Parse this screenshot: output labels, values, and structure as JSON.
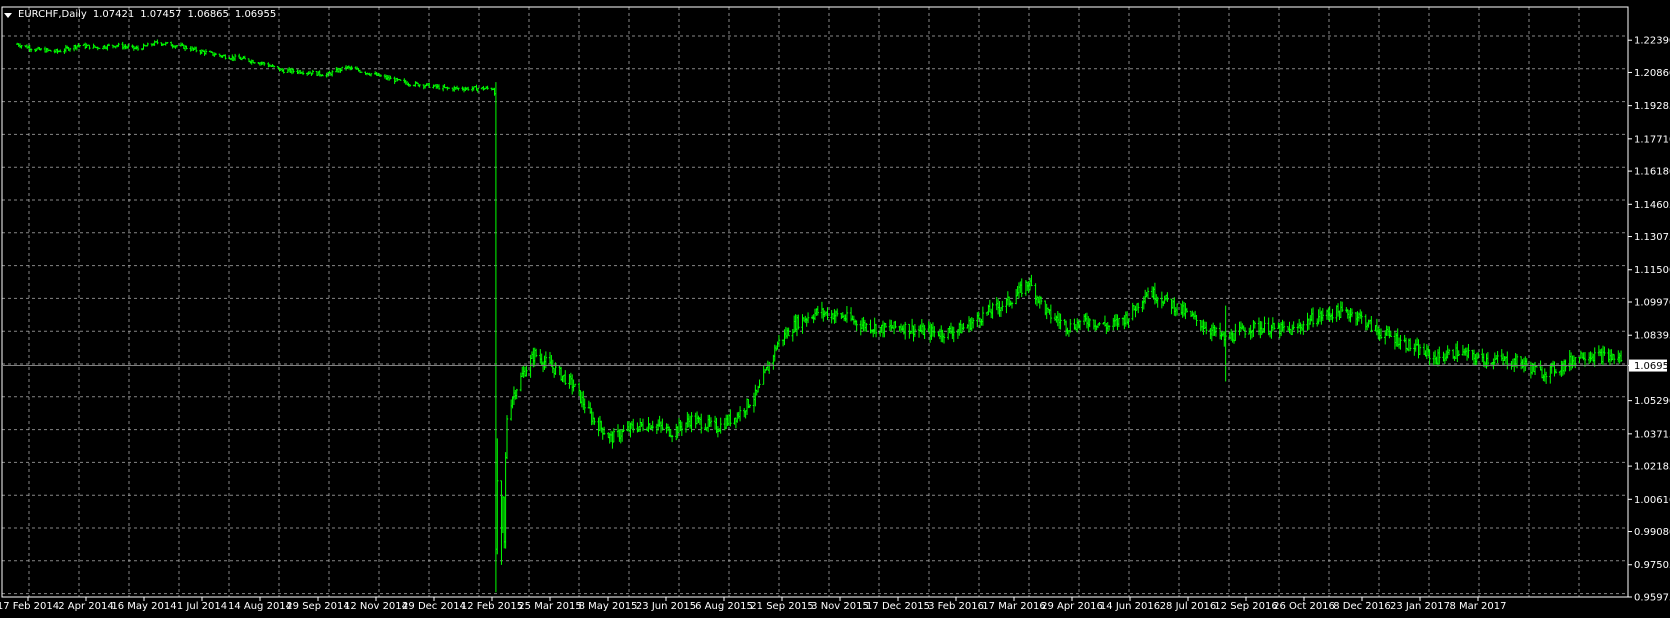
{
  "app": {
    "symbol_label": "EURCHF,Daily",
    "ohlc": [
      "1.07421",
      "1.07457",
      "1.06865",
      "1.06955"
    ]
  },
  "colors": {
    "background": "#000000",
    "bar": "#00ff00",
    "grid": "#c0c0c0",
    "frame": "#ffffff",
    "text": "#ffffff",
    "bid_line": "#808080"
  },
  "chart_data": {
    "type": "line",
    "title": "EURCHF,Daily",
    "xlabel": "",
    "ylabel": "",
    "ylim": [
      0.95975,
      1.23965
    ],
    "grid": true,
    "price_ticks": [
      "1.22390",
      "1.20860",
      "1.19285",
      "1.17710",
      "1.16180",
      "1.14605",
      "1.13075",
      "1.11500",
      "1.09970",
      "1.08395",
      "1.06955",
      "1.05290",
      "1.03715",
      "1.02185",
      "1.00610",
      "0.99080",
      "0.97505",
      "0.95975"
    ],
    "current_price": "1.06955",
    "date_ticks": [
      "17 Feb 2014",
      "2 Apr 2014",
      "16 May 2014",
      "1 Jul 2014",
      "14 Aug 2014",
      "29 Sep 2014",
      "12 Nov 2014",
      "29 Dec 2014",
      "12 Feb 2015",
      "25 Mar 2015",
      "8 May 2015",
      "23 Jun 2015",
      "6 Aug 2015",
      "21 Sep 2015",
      "3 Nov 2015",
      "17 Dec 2015",
      "3 Feb 2016",
      "17 Mar 2016",
      "29 Apr 2016",
      "14 Jun 2016",
      "28 Jul 2016",
      "12 Sep 2016",
      "26 Oct 2016",
      "8 Dec 2016",
      "23 Jan 2017",
      "8 Mar 2017"
    ],
    "x": [
      "2014-02-04",
      "2014-02-17",
      "2014-03-05",
      "2014-03-20",
      "2014-04-02",
      "2014-04-16",
      "2014-05-02",
      "2014-05-16",
      "2014-06-02",
      "2014-06-17",
      "2014-07-01",
      "2014-07-16",
      "2014-07-31",
      "2014-08-14",
      "2014-08-29",
      "2014-09-15",
      "2014-09-29",
      "2014-10-14",
      "2014-10-28",
      "2014-11-12",
      "2014-11-26",
      "2014-12-10",
      "2014-12-26",
      "2015-01-14",
      "2015-01-15",
      "2015-01-16",
      "2015-01-19",
      "2015-01-20",
      "2015-01-21",
      "2015-01-22",
      "2015-01-23",
      "2015-01-27",
      "2015-02-03",
      "2015-02-12",
      "2015-02-26",
      "2015-03-12",
      "2015-03-25",
      "2015-04-08",
      "2015-04-23",
      "2015-05-08",
      "2015-05-22",
      "2015-06-05",
      "2015-06-23",
      "2015-07-08",
      "2015-07-22",
      "2015-08-06",
      "2015-08-20",
      "2015-09-04",
      "2015-09-21",
      "2015-10-06",
      "2015-10-20",
      "2015-11-03",
      "2015-11-17",
      "2015-12-02",
      "2015-12-17",
      "2016-01-05",
      "2016-01-20",
      "2016-02-03",
      "2016-02-17",
      "2016-03-03",
      "2016-03-17",
      "2016-04-01",
      "2016-04-15",
      "2016-04-29",
      "2016-05-13",
      "2016-05-27",
      "2016-06-14",
      "2016-06-24",
      "2016-07-13",
      "2016-07-28",
      "2016-08-11",
      "2016-08-26",
      "2016-09-12",
      "2016-09-26",
      "2016-10-11",
      "2016-10-26",
      "2016-11-09",
      "2016-11-23",
      "2016-12-08",
      "2016-12-22",
      "2017-01-09",
      "2017-01-23",
      "2017-02-06",
      "2017-02-21",
      "2017-03-08",
      "2017-03-22",
      "2017-04-05"
    ],
    "series": [
      {
        "name": "",
        "values": [
          1.222,
          1.2195,
          1.2185,
          1.2215,
          1.2205,
          1.2215,
          1.2198,
          1.2228,
          1.221,
          1.2185,
          1.2165,
          1.215,
          1.213,
          1.2095,
          1.209,
          1.2075,
          1.211,
          1.2085,
          1.206,
          1.2035,
          1.2025,
          1.201,
          1.201,
          1.201,
          0.98,
          1.015,
          0.99,
          1.005,
          0.985,
          1.025,
          1.045,
          1.055,
          1.065,
          1.075,
          1.068,
          1.06,
          1.045,
          1.035,
          1.04,
          1.042,
          1.038,
          1.044,
          1.04,
          1.046,
          1.056,
          1.08,
          1.09,
          1.095,
          1.093,
          1.089,
          1.087,
          1.088,
          1.086,
          1.085,
          1.087,
          1.095,
          1.1,
          1.109,
          1.094,
          1.088,
          1.091,
          1.088,
          1.093,
          1.105,
          1.1,
          1.094,
          1.086,
          1.082,
          1.088,
          1.087,
          1.086,
          1.092,
          1.095,
          1.094,
          1.086,
          1.082,
          1.077,
          1.073,
          1.076,
          1.073,
          1.072,
          1.071,
          1.066,
          1.069,
          1.075,
          1.074,
          1.073
        ]
      }
    ]
  }
}
